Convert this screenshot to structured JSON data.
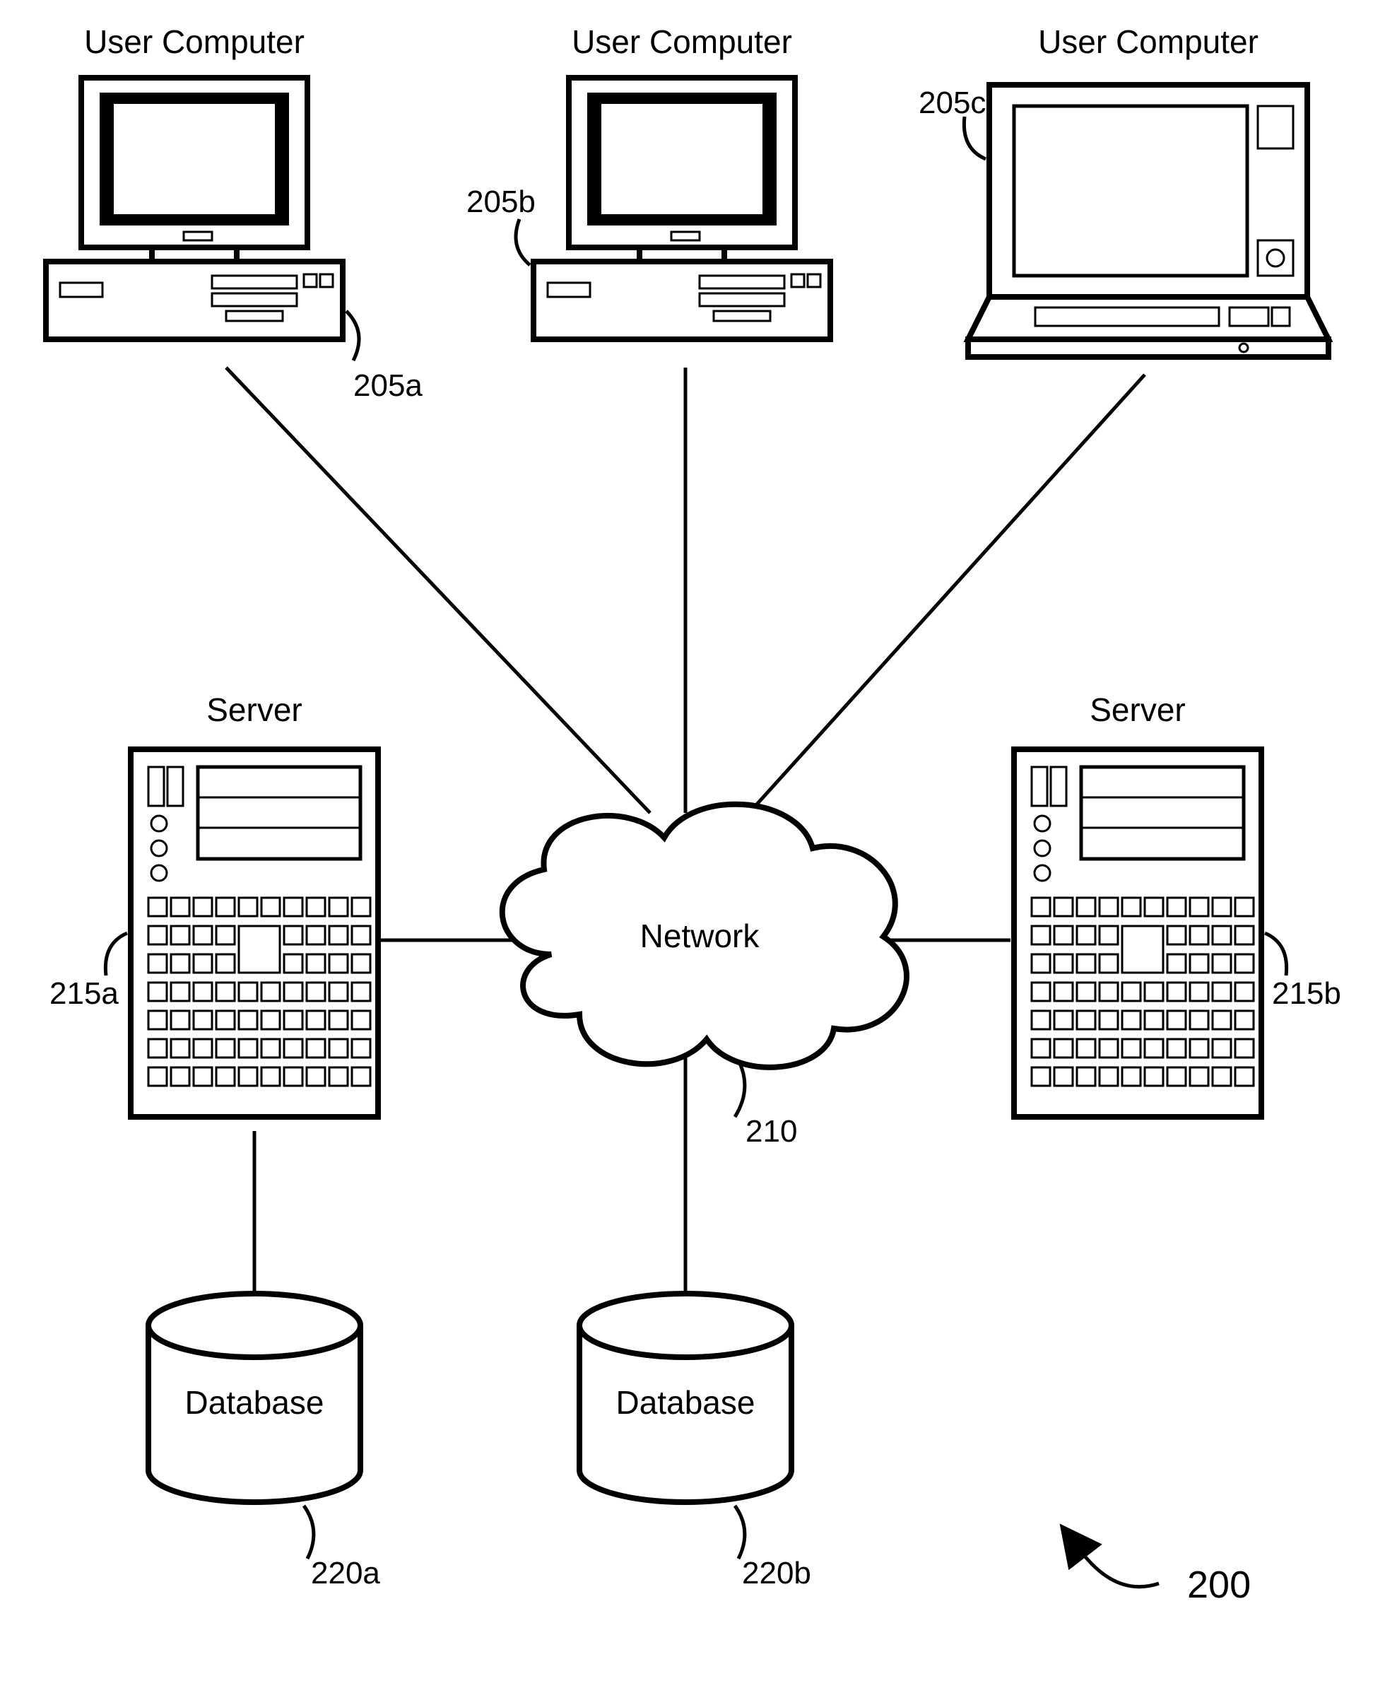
{
  "labels": {
    "userComputerA": "User Computer",
    "userComputerB": "User Computer",
    "userComputerC": "User Computer",
    "serverA": "Server",
    "serverB": "Server",
    "network": "Network",
    "databaseA": "Database",
    "databaseB": "Database"
  },
  "refs": {
    "uc_a": "205a",
    "uc_b": "205b",
    "uc_c": "205c",
    "net": "210",
    "srv_a": "215a",
    "srv_b": "215b",
    "db_a": "220a",
    "db_b": "220b",
    "figure": "200"
  }
}
